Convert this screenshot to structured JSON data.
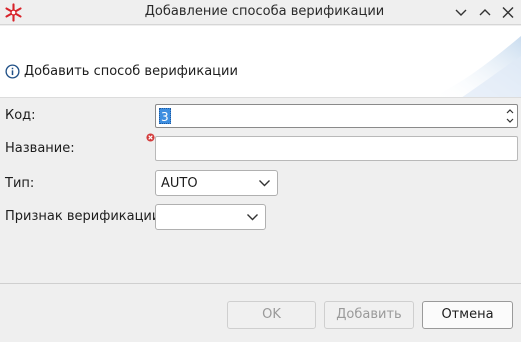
{
  "window": {
    "title": "Добавление способа верификации",
    "icon": "snowflake-app-icon"
  },
  "header": {
    "message": "Добавить способ верификации",
    "icon": "info-icon"
  },
  "form": {
    "code": {
      "label": "Код:",
      "value": "3"
    },
    "name": {
      "label": "Название:",
      "value": "",
      "error_icon": "error-icon"
    },
    "type": {
      "label": "Тип:",
      "value": "AUTO"
    },
    "verification_sign": {
      "label": "Признак верификации:",
      "value": ""
    }
  },
  "buttons": {
    "ok": "OK",
    "add": "Добавить",
    "cancel": "Отмена"
  },
  "colors": {
    "accent": "#3d8ee0",
    "error": "#d33a3a",
    "brand": "#d8232a"
  }
}
